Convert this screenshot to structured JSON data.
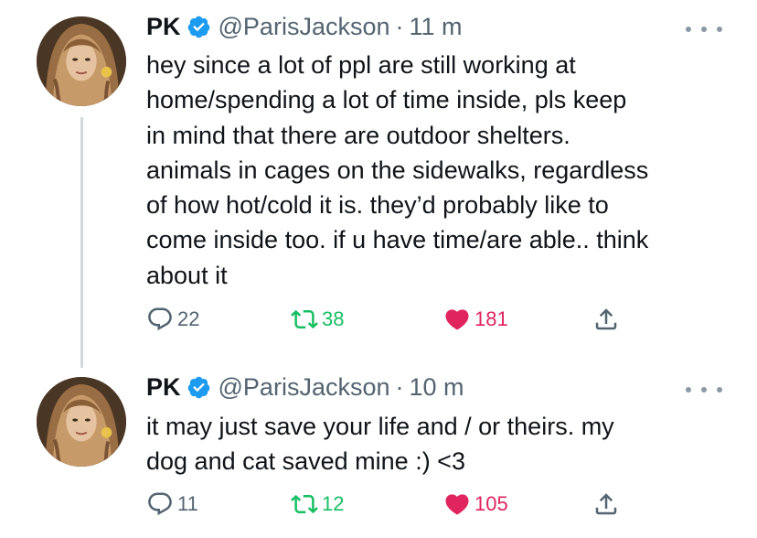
{
  "tweets": [
    {
      "name": "PK",
      "handle": "@ParisJackson",
      "separator": "·",
      "time": "11 m",
      "text_lines": [
        "hey since a lot of ppl are still working at",
        "home/spending a lot of time inside, pls keep",
        "in mind that there are outdoor shelters.",
        "animals in cages on the sidewalks, regardless",
        "of how hot/cold it is. they’d probably like to",
        "come inside too. if u have time/are able.. think",
        "about it"
      ],
      "replies": "22",
      "retweets": "38",
      "likes": "181",
      "retweeted": true,
      "liked": true
    },
    {
      "name": "PK",
      "handle": "@ParisJackson",
      "separator": "·",
      "time": "10 m",
      "text_lines": [
        "it may just save your life and / or theirs. my",
        "dog and cat saved mine :) <3"
      ],
      "replies": "11",
      "retweets": "12",
      "likes": "105",
      "retweeted": true,
      "liked": true
    }
  ],
  "colors": {
    "verified": "#1d9bf0",
    "retweet_active": "#17bf63",
    "like_active": "#e0245e",
    "secondary_text": "#536471"
  },
  "icons": [
    "verified-badge-icon",
    "more-options-icon",
    "reply-icon",
    "retweet-icon",
    "like-icon",
    "share-icon"
  ]
}
